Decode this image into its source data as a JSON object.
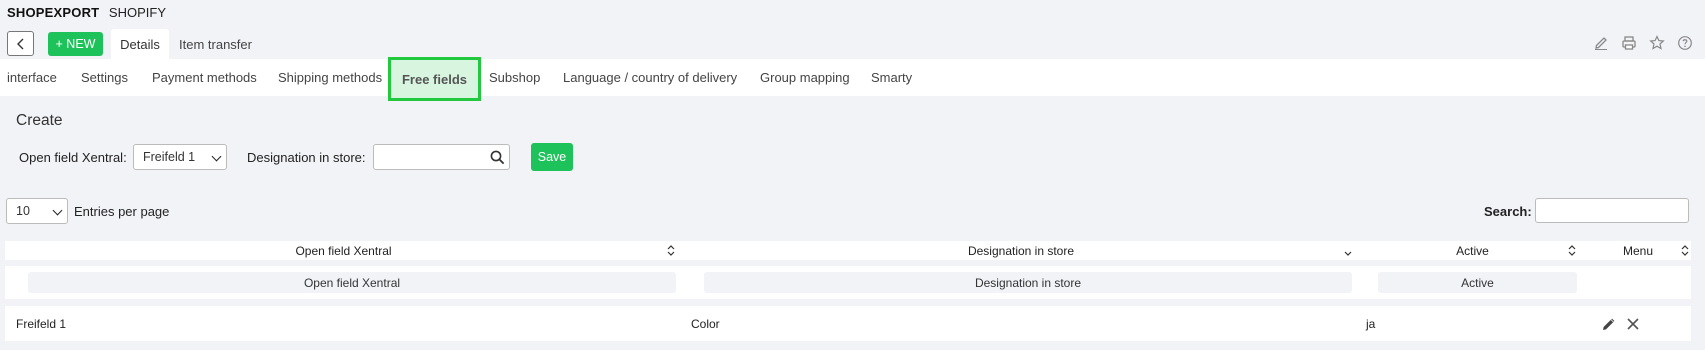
{
  "header": {
    "module": "SHOPEXPORT",
    "sub": "SHOPIFY"
  },
  "toolbar": {
    "new_label": "+ NEW",
    "tab_details": "Details",
    "tab_transfer": "Item transfer"
  },
  "subnav": [
    {
      "label": "interface"
    },
    {
      "label": "Settings"
    },
    {
      "label": "Payment methods"
    },
    {
      "label": "Shipping methods"
    },
    {
      "label": "Free fields"
    },
    {
      "label": "Subshop"
    },
    {
      "label": "Language / country of delivery"
    },
    {
      "label": "Group mapping"
    },
    {
      "label": "Smarty"
    }
  ],
  "create": {
    "heading": "Create",
    "open_field_label": "Open field Xentral:",
    "open_field_value": "Freifeld 1",
    "designation_label": "Designation in store:",
    "designation_value": "",
    "save_label": "Save"
  },
  "table_controls": {
    "entries_value": "10",
    "entries_label": "Entries per page",
    "search_label": "Search:",
    "search_value": ""
  },
  "table": {
    "columns": [
      "Open field Xentral",
      "Designation in store",
      "Active",
      "Menu"
    ],
    "filters": [
      "Open field Xentral",
      "Designation in store",
      "Active"
    ],
    "rows": [
      {
        "open_field": "Freifeld 1",
        "designation": "Color",
        "active": "ja"
      }
    ]
  },
  "colors": {
    "accent": "#1ec25a",
    "highlight_border": "#22c93f",
    "highlight_fill": "#d8f5df",
    "background": "#f2f3f7"
  }
}
